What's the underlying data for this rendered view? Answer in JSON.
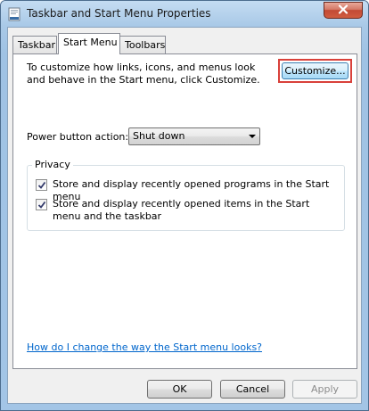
{
  "window": {
    "title": "Taskbar and Start Menu Properties",
    "app_icon": "taskbar-properties-icon",
    "close_icon": "close-icon"
  },
  "tabs": [
    {
      "label": "Taskbar",
      "active": false
    },
    {
      "label": "Start Menu",
      "active": true
    },
    {
      "label": "Toolbars",
      "active": false
    }
  ],
  "start_menu": {
    "description": "To customize how links, icons, and menus look and behave in the Start menu, click Customize.",
    "customize_label": "Customize...",
    "power_button_label": "Power button action:",
    "power_button_value": "Shut down",
    "privacy": {
      "title": "Privacy",
      "options": [
        {
          "label": "Store and display recently opened programs in the Start menu",
          "checked": true
        },
        {
          "label": "Store and display recently opened items in the Start menu and the taskbar",
          "checked": true
        }
      ]
    },
    "help_link": "How do I change the way the Start menu looks?"
  },
  "buttons": {
    "ok": "OK",
    "cancel": "Cancel",
    "apply": "Apply"
  },
  "colors": {
    "highlight_border": "#d9403a",
    "link": "#0066cc",
    "close_button": "#c24a34"
  }
}
